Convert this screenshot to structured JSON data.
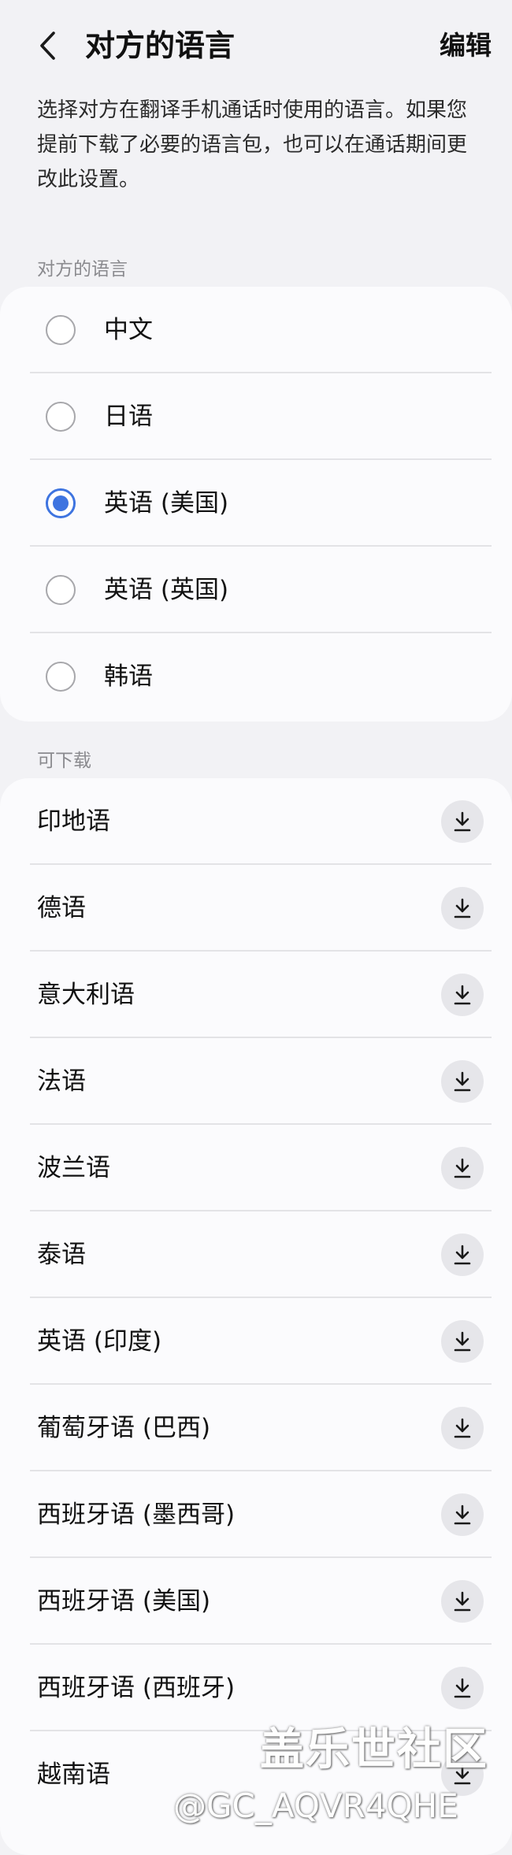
{
  "header": {
    "back_icon": "chevron-left-icon",
    "title": "对方的语言",
    "edit_label": "编辑"
  },
  "description": "选择对方在翻译手机通话时使用的语言。如果您提前下载了必要的语言包，也可以在通话期间更改此设置。",
  "selected_section": {
    "label": "对方的语言",
    "items": [
      {
        "label": "中文",
        "checked": false
      },
      {
        "label": "日语",
        "checked": false
      },
      {
        "label": "英语 (美国)",
        "checked": true
      },
      {
        "label": "英语 (英国)",
        "checked": false
      },
      {
        "label": "韩语",
        "checked": false
      }
    ]
  },
  "download_section": {
    "label": "可下载",
    "icon": "download-icon",
    "items": [
      {
        "label": "印地语"
      },
      {
        "label": "德语"
      },
      {
        "label": "意大利语"
      },
      {
        "label": "法语"
      },
      {
        "label": "波兰语"
      },
      {
        "label": "泰语"
      },
      {
        "label": "英语 (印度)"
      },
      {
        "label": "葡萄牙语 (巴西)"
      },
      {
        "label": "西班牙语 (墨西哥)"
      },
      {
        "label": "西班牙语 (美国)"
      },
      {
        "label": "西班牙语 (西班牙)"
      },
      {
        "label": "越南语"
      }
    ]
  },
  "colors": {
    "accent": "#3e74e0",
    "background": "#f2f2f5",
    "card": "#fbfbfd"
  },
  "watermark": {
    "brand": "盖乐世社区",
    "handle": "@GC_AQVR4QHE"
  }
}
